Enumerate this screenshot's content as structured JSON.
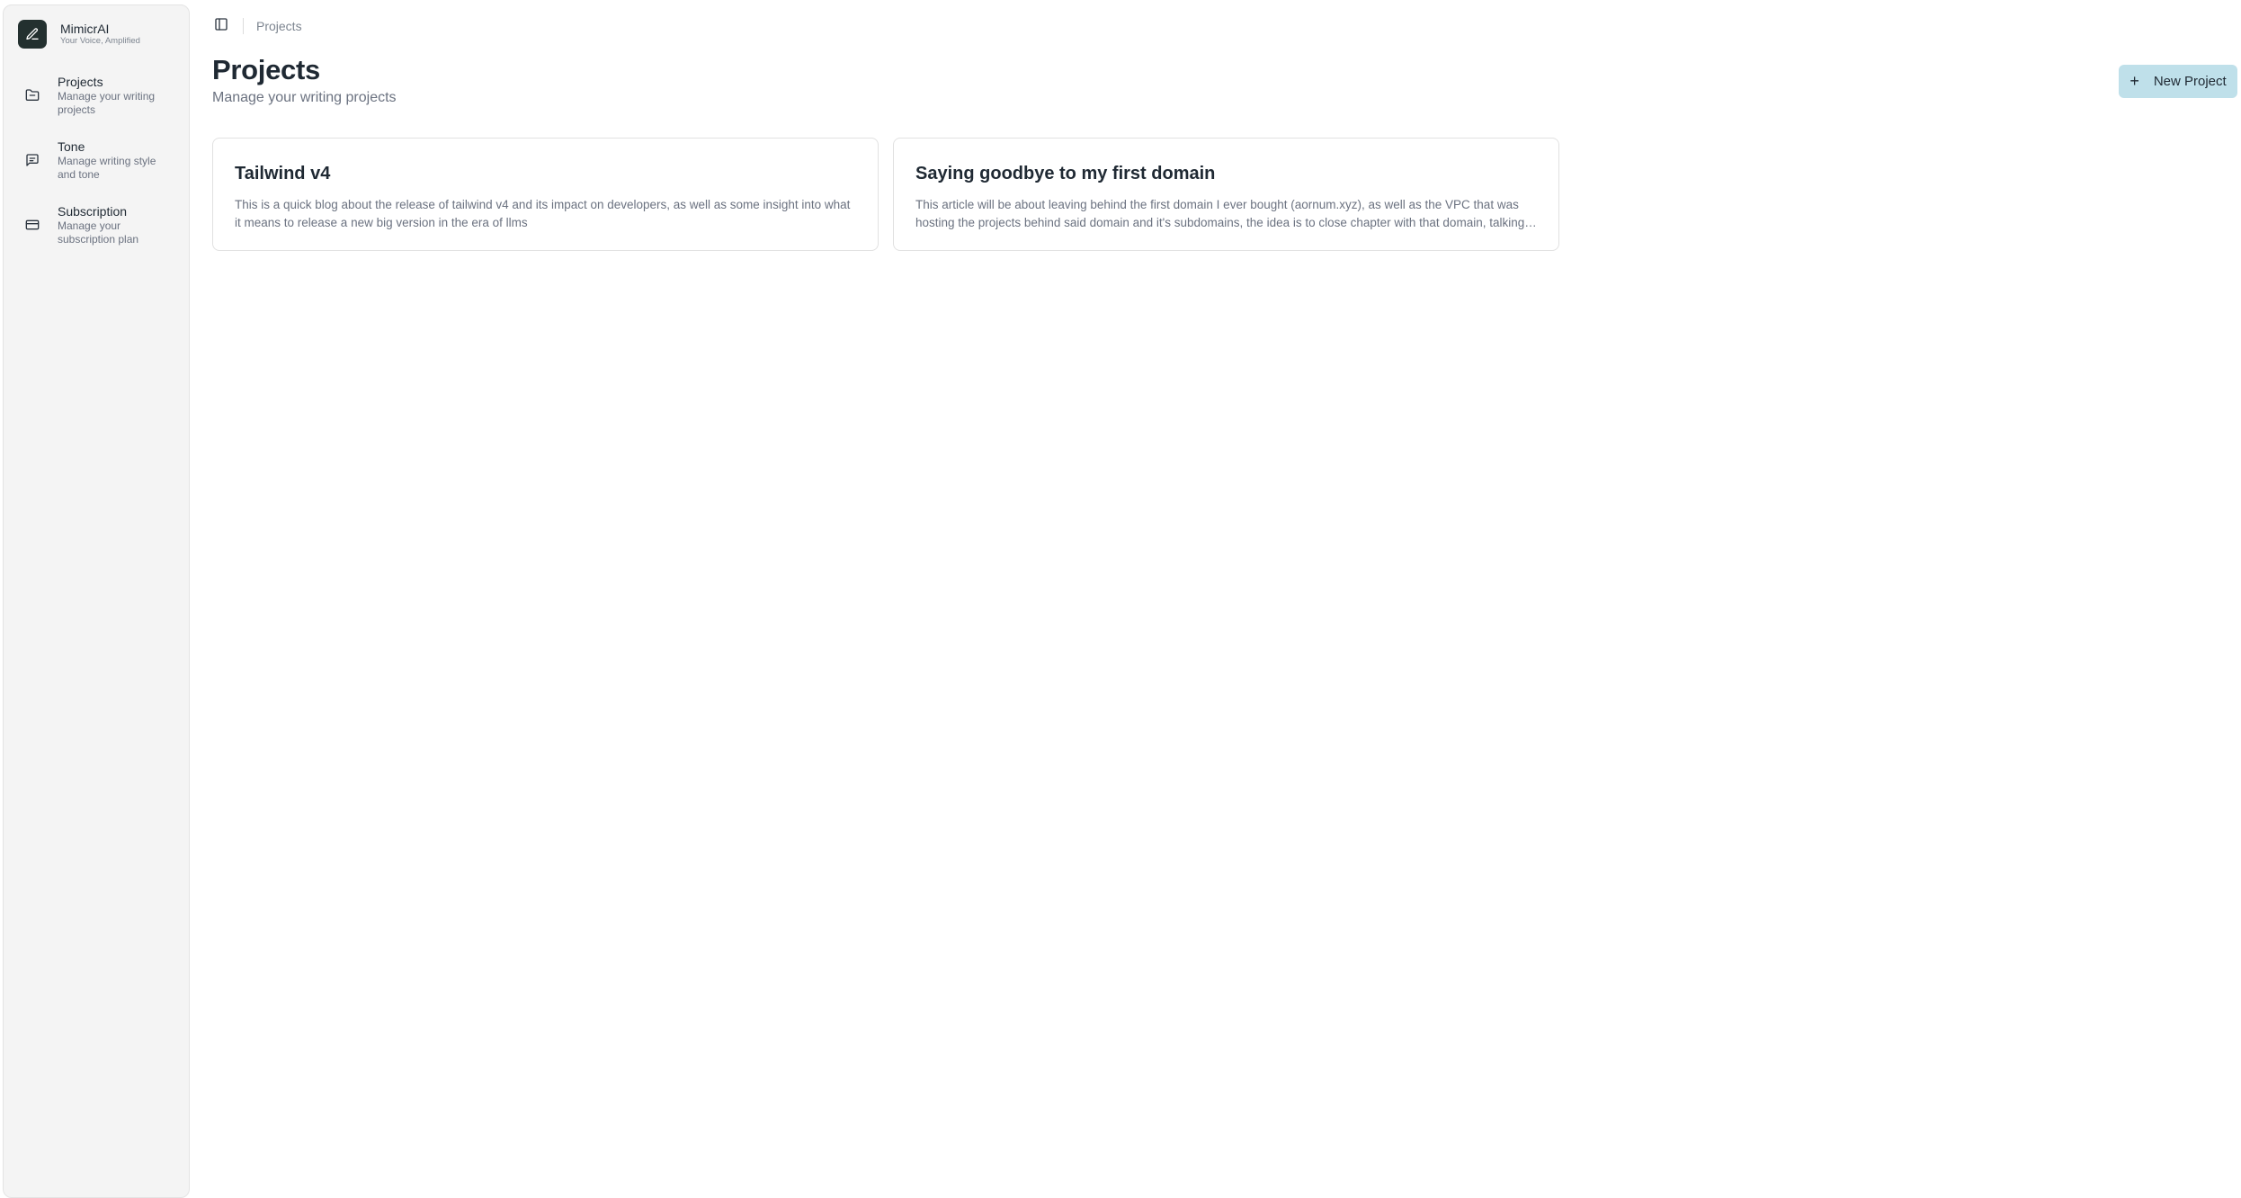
{
  "brand": {
    "name": "MimicrAI",
    "tagline": "Your Voice, Amplified"
  },
  "sidebar": {
    "items": [
      {
        "title": "Projects",
        "desc": "Manage your writing projects",
        "icon": "folder-icon"
      },
      {
        "title": "Tone",
        "desc": "Manage writing style and tone",
        "icon": "message-square-icon"
      },
      {
        "title": "Subscription",
        "desc": "Manage your subscription plan",
        "icon": "credit-card-icon"
      }
    ]
  },
  "topbar": {
    "breadcrumb": "Projects",
    "toggle_icon": "sidebar-toggle-icon"
  },
  "main": {
    "title": "Projects",
    "subtitle": "Manage your writing projects",
    "new_button_label": "New Project",
    "new_button_icon": "+",
    "projects": [
      {
        "title": "Tailwind v4",
        "description": "This is a quick blog about the release of tailwind v4 and its impact on developers, as well as some insight into what it means to release a new big version in the era of llms"
      },
      {
        "title": "Saying goodbye to my first domain",
        "description": "This article will be about leaving behind the first domain I ever bought (aornum.xyz), as well as the VPC that was hosting the projects behind said domain and it's subdomains, the idea is to close chapter with that domain, talking about the projects and memories"
      }
    ]
  },
  "colors": {
    "accent_button": "#bfe0ea",
    "logo_bg": "#23302f",
    "sidebar_bg": "#f4f4f4"
  }
}
